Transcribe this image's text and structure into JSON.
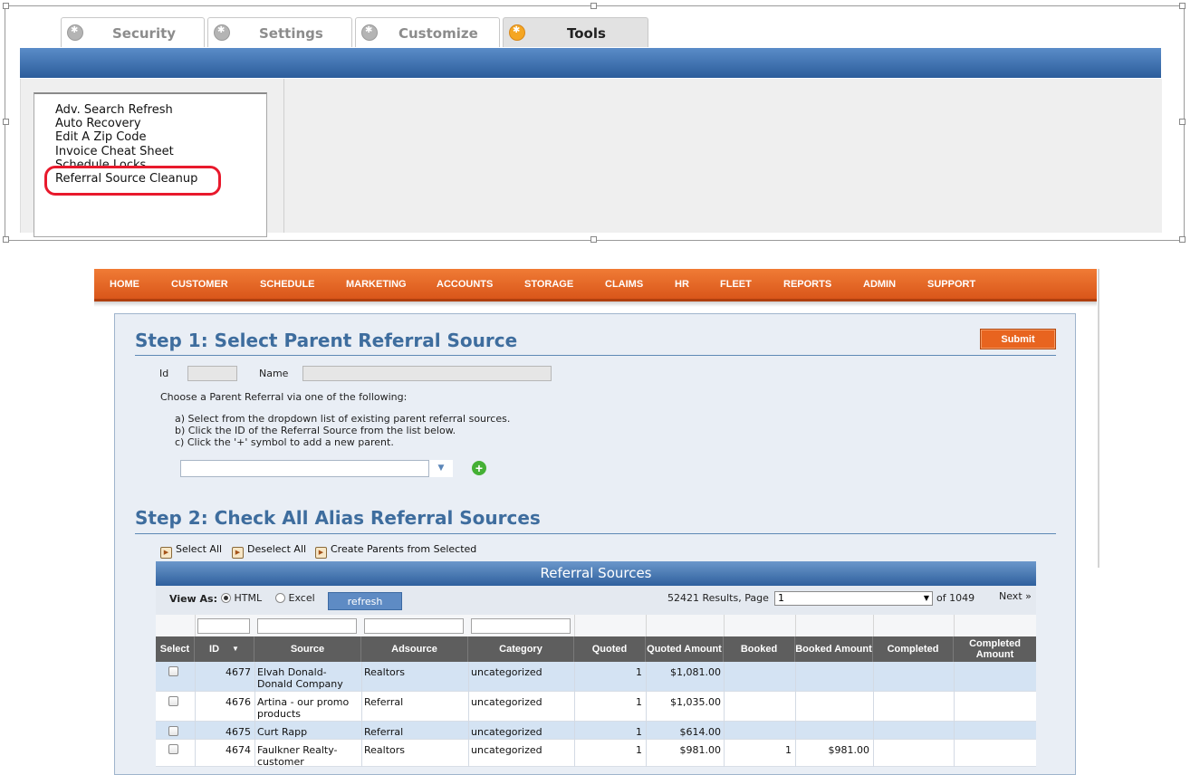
{
  "tools_panel": {
    "tabs": [
      {
        "label": "Security",
        "icon": "gear-icon"
      },
      {
        "label": "Settings",
        "icon": "gear-icon"
      },
      {
        "label": "Customize",
        "icon": "gear-icon"
      },
      {
        "label": "Tools",
        "icon": "gear-icon",
        "active": true
      }
    ],
    "items": [
      "Adv. Search Refresh",
      "Auto Recovery",
      "Edit A Zip Code",
      "Invoice Cheat Sheet",
      "Schedule Locks",
      "Referral Source Cleanup"
    ],
    "highlighted_item": "Referral Source Cleanup",
    "highlight_color": "#e8192c"
  },
  "nav": {
    "items": [
      "HOME",
      "CUSTOMER",
      "SCHEDULE",
      "MARKETING",
      "ACCOUNTS",
      "STORAGE",
      "CLAIMS",
      "HR",
      "FLEET",
      "REPORTS",
      "ADMIN",
      "SUPPORT"
    ],
    "color": "#e8641f"
  },
  "step1": {
    "title": "Step 1: Select Parent Referral Source",
    "submit_label": "Submit",
    "id_label": "Id",
    "name_label": "Name",
    "id_value": "",
    "name_value": "",
    "instructions": "Choose a Parent Referral via one of the following:",
    "options": [
      "a) Select from the dropdown list of existing parent referral sources.",
      "b) Click the ID of the Referral Source from the list below.",
      "c) Click the '+' symbol to add a new parent."
    ],
    "dropdown_value": "",
    "add_icon": "plus-circle-icon"
  },
  "step2": {
    "title": "Step 2: Check All Alias Referral Sources",
    "actions": [
      "Select All",
      "Deselect All",
      "Create Parents from Selected"
    ]
  },
  "grid": {
    "title": "Referral Sources",
    "view_as_label": "View As:",
    "view_options": [
      {
        "label": "HTML",
        "selected": true
      },
      {
        "label": "Excel",
        "selected": false
      }
    ],
    "refresh_label": "refresh",
    "results_text": "52421 Results, Page",
    "page_value": "1",
    "page_total": "of 1049",
    "next_label": "Next »",
    "columns": [
      "Select",
      "ID",
      "Source",
      "Adsource",
      "Category",
      "Quoted",
      "Quoted Amount",
      "Booked",
      "Booked Amount",
      "Completed",
      "Completed Amount"
    ],
    "sort_indicator": "▼",
    "rows": [
      {
        "id": "4677",
        "source": "Elvah Donald-Donald Company",
        "adsource": "Realtors",
        "category": "uncategorized",
        "quoted": "1",
        "quoted_amount": "$1,081.00",
        "booked": "",
        "booked_amount": "",
        "completed": "",
        "completed_amount": ""
      },
      {
        "id": "4676",
        "source": "Artina - our promo products",
        "adsource": "Referral",
        "category": "uncategorized",
        "quoted": "1",
        "quoted_amount": "$1,035.00",
        "booked": "",
        "booked_amount": "",
        "completed": "",
        "completed_amount": ""
      },
      {
        "id": "4675",
        "source": "Curt Rapp",
        "adsource": "Referral",
        "category": "uncategorized",
        "quoted": "1",
        "quoted_amount": "$614.00",
        "booked": "",
        "booked_amount": "",
        "completed": "",
        "completed_amount": ""
      },
      {
        "id": "4674",
        "source": "Faulkner Realty-customer",
        "adsource": "Realtors",
        "category": "uncategorized",
        "quoted": "1",
        "quoted_amount": "$981.00",
        "booked": "1",
        "booked_amount": "$981.00",
        "completed": "",
        "completed_amount": ""
      }
    ]
  }
}
